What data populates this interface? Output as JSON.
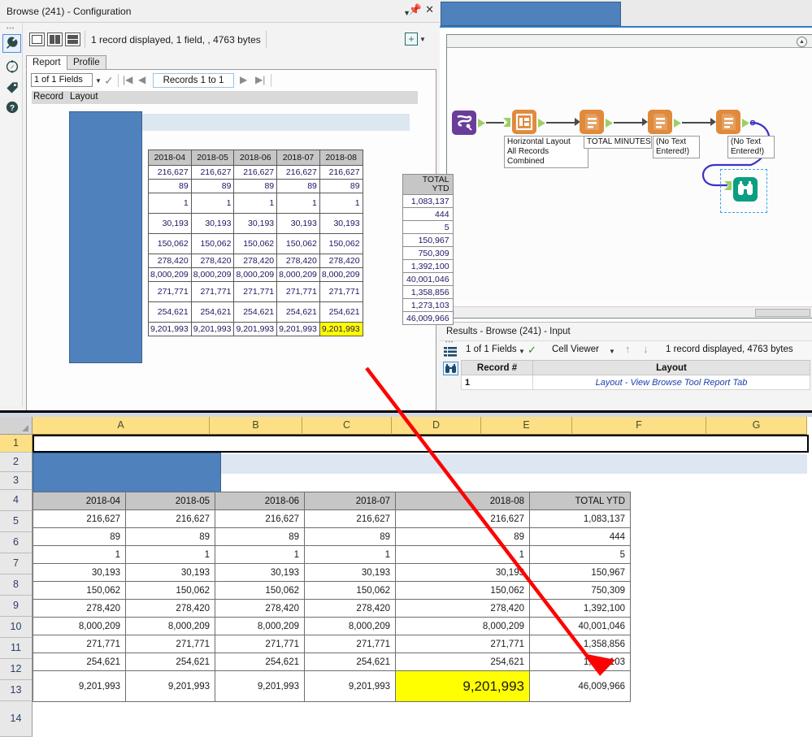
{
  "config_panel": {
    "title": "Browse (241) - Configuration",
    "titlebar_buttons": [
      "dropdown-caret",
      "pin",
      "close"
    ],
    "status_text": "1 record displayed, 1 field, , 4763 bytes",
    "view_buttons": [
      "single-view",
      "side-by-side-view",
      "stacked-view"
    ],
    "add_button": "+",
    "tabs": [
      {
        "label": "Report",
        "active": true
      },
      {
        "label": "Profile",
        "active": false
      }
    ],
    "nav": {
      "fields_selector": "1 of 1 Fields",
      "records_box": "Records 1 to 1",
      "first": "|◀",
      "prev": "◀",
      "next": "▶",
      "last": "▶|"
    },
    "record_layout": {
      "col_record": "Record",
      "col_layout": "Layout",
      "row_number": "1"
    }
  },
  "report_matrix": {
    "headers": [
      "2018-04",
      "2018-05",
      "2018-06",
      "2018-07",
      "2018-08"
    ],
    "rows": [
      {
        "values": [
          "216,627",
          "216,627",
          "216,627",
          "216,627",
          "216,627"
        ],
        "tall": false,
        "highlight": false
      },
      {
        "values": [
          "89",
          "89",
          "89",
          "89",
          "89"
        ],
        "tall": false,
        "highlight": false
      },
      {
        "values": [
          "1",
          "1",
          "1",
          "1",
          "1"
        ],
        "tall": true,
        "highlight": false
      },
      {
        "values": [
          "30,193",
          "30,193",
          "30,193",
          "30,193",
          "30,193"
        ],
        "tall": true,
        "highlight": false
      },
      {
        "values": [
          "150,062",
          "150,062",
          "150,062",
          "150,062",
          "150,062"
        ],
        "tall": true,
        "highlight": false
      },
      {
        "values": [
          "278,420",
          "278,420",
          "278,420",
          "278,420",
          "278,420"
        ],
        "tall": false,
        "highlight": false
      },
      {
        "values": [
          "8,000,209",
          "8,000,209",
          "8,000,209",
          "8,000,209",
          "8,000,209"
        ],
        "tall": false,
        "highlight": false
      },
      {
        "values": [
          "271,771",
          "271,771",
          "271,771",
          "271,771",
          "271,771"
        ],
        "tall": true,
        "highlight": false
      },
      {
        "values": [
          "254,621",
          "254,621",
          "254,621",
          "254,621",
          "254,621"
        ],
        "tall": true,
        "highlight": false
      },
      {
        "values": [
          "9,201,993",
          "9,201,993",
          "9,201,993",
          "9,201,993",
          "9,201,993"
        ],
        "tall": false,
        "highlight": true
      }
    ]
  },
  "report_ytd": {
    "header_line1": "TOTAL",
    "header_line2": "YTD",
    "values": [
      "1,083,137",
      "444",
      "5",
      "150,967",
      "750,309",
      "1,392,100",
      "40,001,046",
      "1,358,856",
      "1,273,103",
      "46,009,966"
    ]
  },
  "workflow": {
    "collapse_icon": "collapse-chevron",
    "nodes": [
      {
        "id": "n1",
        "icon": "data-tool-icon",
        "color": "#6b3d9a",
        "label": ""
      },
      {
        "id": "n2",
        "icon": "layout-tool-icon",
        "color": "#e08a3c",
        "label": "Horizontal Layout\nAll Records\nCombined"
      },
      {
        "id": "n3",
        "icon": "report-text-tool-icon",
        "color": "#e08a3c",
        "label": "TOTAL MINUTES"
      },
      {
        "id": "n4",
        "icon": "report-text-tool-icon",
        "color": "#e08a3c",
        "label": "(No Text\nEntered!)"
      },
      {
        "id": "n5",
        "icon": "report-text-tool-icon",
        "color": "#e08a3c",
        "label": "(No Text\nEntered!)"
      },
      {
        "id": "n6",
        "icon": "browse-binoculars-icon",
        "color": "#0b9e83",
        "label": "",
        "selected": true
      }
    ],
    "node_labels": {
      "layout": [
        "Horizontal Layout",
        "All Records",
        "Combined"
      ],
      "total_minutes": "TOTAL MINUTES",
      "no_text_1": [
        "(No Text",
        "Entered!)"
      ],
      "no_text_2": [
        "(No Text",
        "Entered!)"
      ]
    }
  },
  "results_pane": {
    "title": "Results - Browse (241) - Input",
    "toolbar": {
      "fields_selector": "1 of 1 Fields",
      "viewer_selector": "Cell Viewer",
      "status": "1 record displayed, 4763 bytes",
      "up_arrow": "↑",
      "down_arrow": "↓",
      "list_icon": "list-view-icon",
      "check_icon": "check-icon",
      "binoculars_icon": "browse-binoculars-icon"
    },
    "grid": {
      "headers": [
        "Record #",
        "Layout"
      ],
      "rows": [
        [
          "1",
          "Layout - View Browse Tool Report Tab"
        ]
      ]
    }
  },
  "spreadsheet": {
    "columns": [
      "A",
      "B",
      "C",
      "D",
      "E",
      "F",
      "G"
    ],
    "rows": [
      "1",
      "2",
      "3",
      "4",
      "5",
      "6",
      "7",
      "8",
      "9",
      "10",
      "11",
      "12",
      "13",
      "14"
    ],
    "selected_row": "1",
    "headers": [
      "2018-04",
      "2018-05",
      "2018-06",
      "2018-07",
      "2018-08",
      "TOTAL YTD"
    ],
    "data_rows": [
      {
        "row": "5",
        "values": [
          "216,627",
          "216,627",
          "216,627",
          "216,627",
          "216,627",
          "1,083,137"
        ]
      },
      {
        "row": "6",
        "values": [
          "89",
          "89",
          "89",
          "89",
          "89",
          "444"
        ]
      },
      {
        "row": "7",
        "values": [
          "1",
          "1",
          "1",
          "1",
          "1",
          "5"
        ]
      },
      {
        "row": "8",
        "values": [
          "30,193",
          "30,193",
          "30,193",
          "30,193",
          "30,193",
          "150,967"
        ]
      },
      {
        "row": "9",
        "values": [
          "150,062",
          "150,062",
          "150,062",
          "150,062",
          "150,062",
          "750,309"
        ]
      },
      {
        "row": "10",
        "values": [
          "278,420",
          "278,420",
          "278,420",
          "278,420",
          "278,420",
          "1,392,100"
        ]
      },
      {
        "row": "11",
        "values": [
          "8,000,209",
          "8,000,209",
          "8,000,209",
          "8,000,209",
          "8,000,209",
          "40,001,046"
        ]
      },
      {
        "row": "12",
        "values": [
          "271,771",
          "271,771",
          "271,771",
          "271,771",
          "271,771",
          "1,358,856"
        ]
      },
      {
        "row": "13",
        "values": [
          "254,621",
          "254,621",
          "254,621",
          "254,621",
          "254,621",
          "1,273,103"
        ]
      },
      {
        "row": "14",
        "values": [
          "9,201,993",
          "9,201,993",
          "9,201,993",
          "9,201,993",
          "9,201,993",
          "46,009,966"
        ],
        "highlight_index": 4
      }
    ]
  },
  "annotation": {
    "arrow_color": "#ff0000",
    "description": "red-arrow-from-report-total-to-spreadsheet-total"
  },
  "colors": {
    "redaction_blue": "#4f81bd",
    "highlight_yellow": "#ffff00",
    "header_gray": "#c6c6c6",
    "col_header_yellow": "#fde086",
    "accent_blue": "#2e7cc4",
    "node_orange": "#e08a3c",
    "node_purple": "#6b3d9a",
    "node_teal": "#0b9e83"
  }
}
